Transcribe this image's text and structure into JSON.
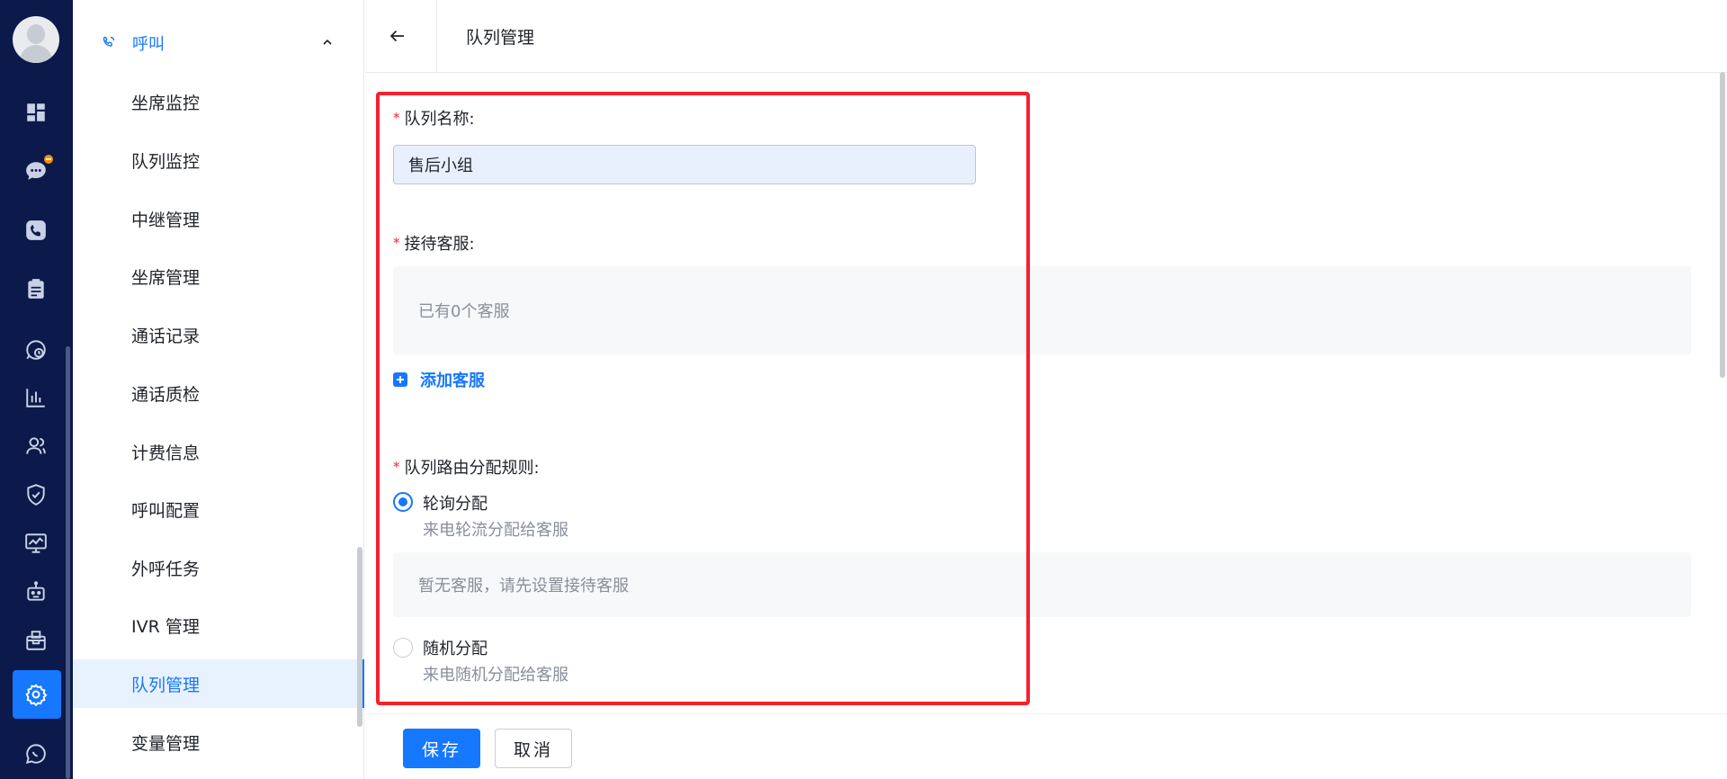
{
  "rail": {
    "icons": [
      "dashboard-icon",
      "chat-icon",
      "phone-icon",
      "clipboard-icon",
      "history-chat-icon",
      "bar-chart-icon",
      "users-icon",
      "shield-check-icon",
      "monitor-chart-icon",
      "robot-icon",
      "mail-box-icon",
      "gear-icon",
      "message-circle-icon"
    ],
    "active": "gear-icon"
  },
  "menu": {
    "group_label": "呼叫",
    "items": [
      {
        "label": "坐席监控"
      },
      {
        "label": "队列监控"
      },
      {
        "label": "中继管理"
      },
      {
        "label": "坐席管理"
      },
      {
        "label": "通话记录"
      },
      {
        "label": "通话质检"
      },
      {
        "label": "计费信息"
      },
      {
        "label": "呼叫配置"
      },
      {
        "label": "外呼任务"
      },
      {
        "label": "IVR 管理"
      },
      {
        "label": "队列管理"
      },
      {
        "label": "变量管理"
      }
    ],
    "active_item": "队列管理"
  },
  "header": {
    "title": "队列管理"
  },
  "form": {
    "queue_name": {
      "label": "队列名称:",
      "value": "售后小组"
    },
    "agents": {
      "label": "接待客服:",
      "empty_text": "已有0个客服",
      "add_label": "添加客服"
    },
    "routing": {
      "label": "队列路由分配规则:",
      "options": [
        {
          "title": "轮询分配",
          "desc": "来电轮流分配给客服",
          "checked": true
        },
        {
          "title": "随机分配",
          "desc": "来电随机分配给客服",
          "checked": false
        }
      ],
      "round_robin_empty": "暂无客服，请先设置接待客服"
    }
  },
  "footer": {
    "save_label": "保存",
    "cancel_label": "取消"
  },
  "colors": {
    "accent": "#1677ff",
    "rail_bg": "#0b1a4a",
    "highlight": "#f5222d",
    "badge": "#ff8a00"
  }
}
